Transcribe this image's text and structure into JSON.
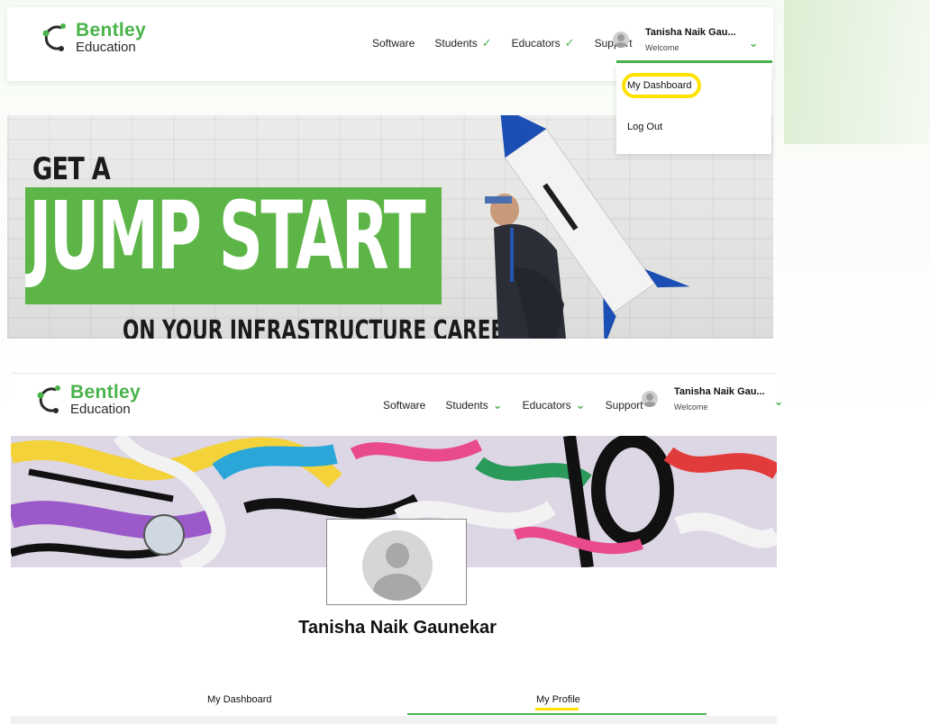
{
  "brand": {
    "name": "Bentley",
    "sub": "Education",
    "green": "#49b34b"
  },
  "header": {
    "nav": [
      {
        "label": "Software",
        "dropdown": false
      },
      {
        "label": "Students",
        "dropdown": true
      },
      {
        "label": "Educators",
        "dropdown": true
      },
      {
        "label": "Support",
        "dropdown": false
      }
    ],
    "user_name": "Tanisha Naik Gau...",
    "user_welcome": "Welcome",
    "chevron_icon": "chevron-down-icon",
    "avatar_icon": "user-avatar-icon"
  },
  "dropdown": {
    "items": [
      "My Dashboard",
      "Log Out"
    ],
    "highlighted_item": "My Dashboard",
    "highlight_color": "#ffe100"
  },
  "banner": {
    "line1": "GET A",
    "line2": "JUMP START",
    "line3": "ON YOUR INFRASTRUCTURE CAREER"
  },
  "profile": {
    "name": "Tanisha Naik Gaunekar",
    "avatar_icon": "profile-avatar-icon",
    "tabs": [
      {
        "label": "My Dashboard",
        "active": false
      },
      {
        "label": "My Profile",
        "active": true
      }
    ]
  }
}
